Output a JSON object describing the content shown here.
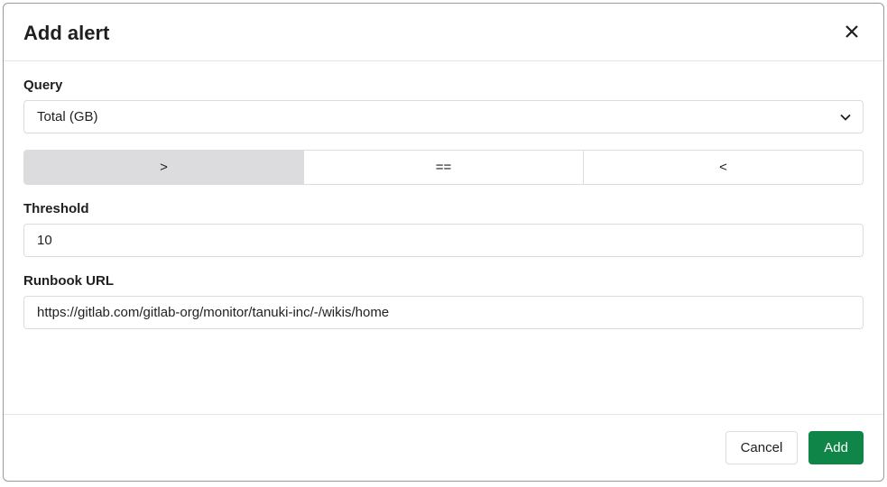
{
  "modal": {
    "title": "Add alert"
  },
  "form": {
    "query_label": "Query",
    "query_value": "Total (GB)",
    "operators": {
      "gt": ">",
      "eq": "==",
      "lt": "<",
      "active": "gt"
    },
    "threshold_label": "Threshold",
    "threshold_value": "10",
    "runbook_label": "Runbook URL",
    "runbook_value": "https://gitlab.com/gitlab-org/monitor/tanuki-inc/-/wikis/home"
  },
  "footer": {
    "cancel_label": "Cancel",
    "submit_label": "Add"
  }
}
